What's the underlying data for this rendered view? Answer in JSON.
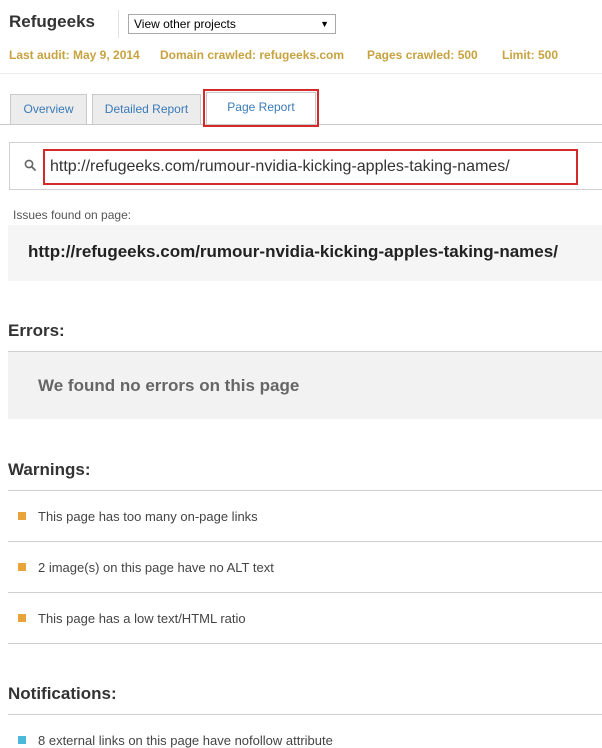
{
  "header": {
    "project_name": "Refugeeks",
    "project_select": "View other projects",
    "stats": {
      "last_audit": "Last audit: May 9, 2014",
      "domain_crawled": "Domain crawled: refugeeks.com",
      "pages_crawled": "Pages crawled: 500",
      "limit": "Limit: 500"
    }
  },
  "tabs": [
    {
      "label": "Overview"
    },
    {
      "label": "Detailed Report"
    },
    {
      "label": "Page Report"
    }
  ],
  "search": {
    "value": "http://refugeeks.com/rumour-nvidia-kicking-apples-taking-names/"
  },
  "issues": {
    "label": "Issues found on page:",
    "url": "http://refugeeks.com/rumour-nvidia-kicking-apples-taking-names/"
  },
  "errors": {
    "title": "Errors:",
    "message": "We found no errors on this page"
  },
  "warnings": {
    "title": "Warnings:",
    "color": "#e8a33a",
    "items": [
      "This page has too many on-page links",
      "2 image(s) on this page have no ALT text",
      "This page has a low text/HTML ratio"
    ]
  },
  "notifications": {
    "title": "Notifications:",
    "color": "#4bbad8",
    "items": [
      "8 external links on this page have nofollow attribute"
    ]
  },
  "colors": {
    "stats_text": "#c7a23f",
    "tab_link": "#3a7ab8",
    "highlight_box": "#d42a2a"
  }
}
